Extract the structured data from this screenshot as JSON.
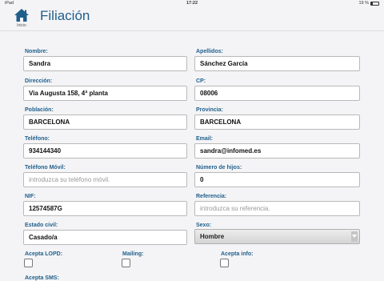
{
  "status_bar": {
    "carrier": "iPad",
    "time": "17:22",
    "battery": "19 %",
    "battery_level": 0.19
  },
  "header": {
    "home_label": "Inicio",
    "title": "Filiación"
  },
  "form": {
    "nombre": {
      "label": "Nombre:",
      "value": "Sandra"
    },
    "apellidos": {
      "label": "Apellidos:",
      "value": "Sánchez García"
    },
    "direccion": {
      "label": "Dirección:",
      "value": "Via Augusta 158, 4ª planta"
    },
    "cp": {
      "label": "CP:",
      "value": "08006"
    },
    "poblacion": {
      "label": "Población:",
      "value": "BARCELONA"
    },
    "provincia": {
      "label": "Provincia:",
      "value": "BARCELONA"
    },
    "telefono": {
      "label": "Teléfono:",
      "value": "934144340"
    },
    "email": {
      "label": "Email:",
      "value": "sandra@infomed.es"
    },
    "telefono_movil": {
      "label": "Teléfono Móvil:",
      "placeholder": "introduzca su teléfono móvil."
    },
    "numero_hijos": {
      "label": "Número de hijos:",
      "value": "0"
    },
    "nif": {
      "label": "NIF:",
      "value": "12574587G"
    },
    "referencia": {
      "label": "Referencia:",
      "placeholder": "introduzca su referencia."
    },
    "estado_civil": {
      "label": "Estado civil:",
      "value": "Casado/a"
    },
    "sexo": {
      "label": "Sexo:",
      "value": "Hombre"
    },
    "acepta_lopd": {
      "label": "Acepta LOPD:",
      "checked": false
    },
    "mailing": {
      "label": "Mailing:",
      "checked": false
    },
    "acepta_info": {
      "label": "Acepta info:",
      "checked": false
    },
    "acepta_sms": {
      "label": "Acepta SMS:"
    }
  },
  "colors": {
    "label": "#1f5f8b",
    "title": "#1f5f8b"
  }
}
